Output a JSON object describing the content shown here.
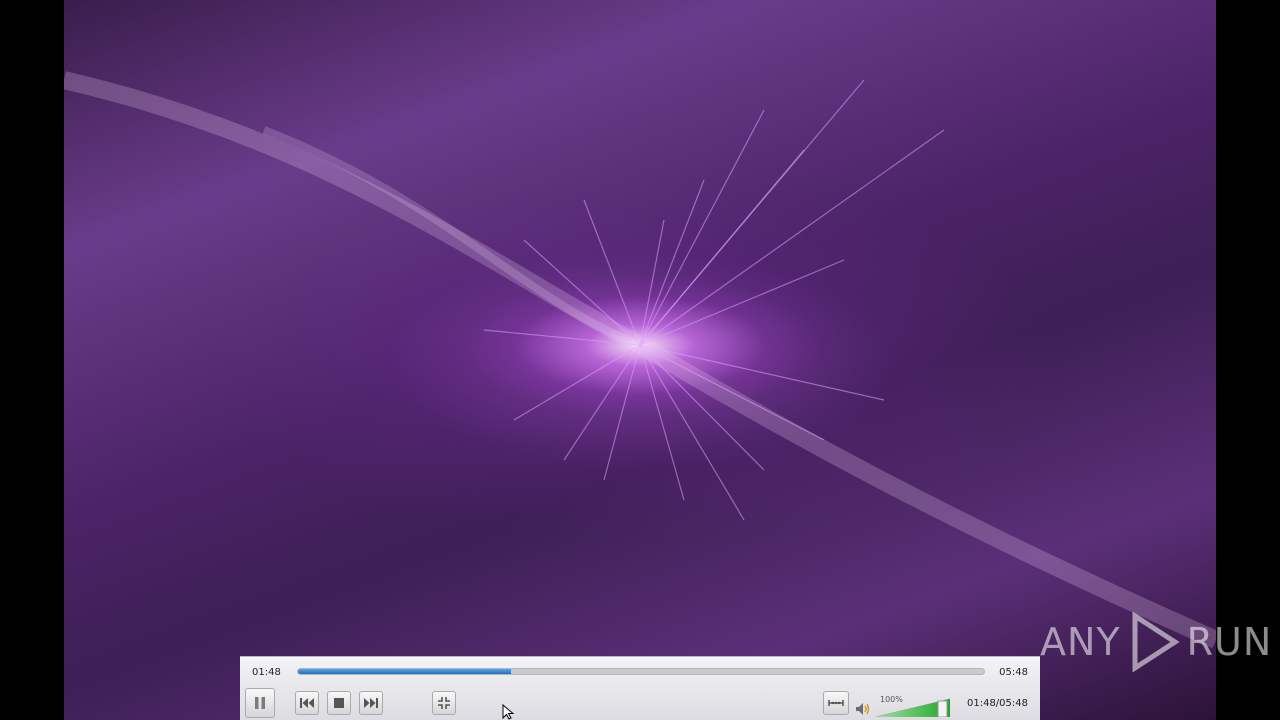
{
  "player": {
    "elapsed": "01:48",
    "total": "05:48",
    "time_combined": "01:48/05:48",
    "seek_progress_fraction": 0.31,
    "volume_percent_label": "100%",
    "volume_level_fraction": 1.0
  },
  "controls": {
    "pause_icon": "pause-icon",
    "previous_icon": "skip-previous-icon",
    "stop_icon": "stop-icon",
    "next_icon": "skip-next-icon",
    "fullscreen_icon": "fullscreen-exit-icon",
    "extended_icon": "extended-settings-icon",
    "volume_icon": "speaker-icon"
  },
  "watermark": {
    "text": "ANY RUN",
    "left_text": "ANY",
    "right_text": "RUN"
  },
  "colors": {
    "seek_fill": "#1f6fc0",
    "volume_fill": "#22a52b",
    "video_accent": "#8a3fc0"
  }
}
